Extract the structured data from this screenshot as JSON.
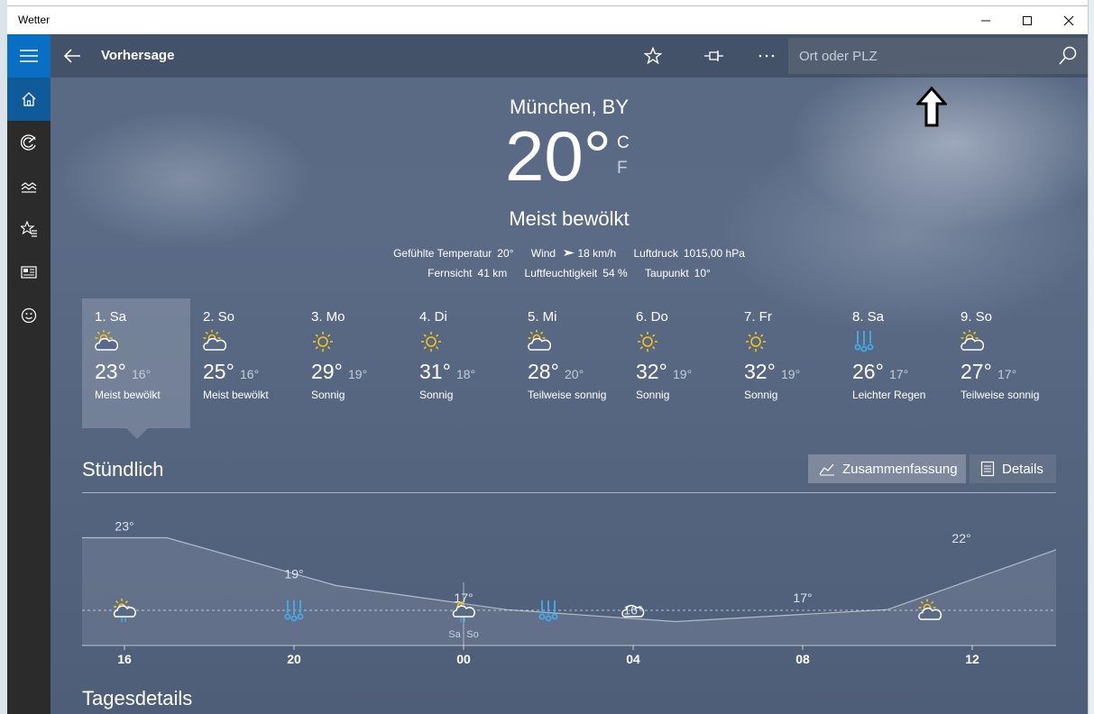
{
  "window": {
    "title": "Wetter",
    "controls": [
      "minimize",
      "maximize",
      "close"
    ]
  },
  "nav": {
    "items": [
      "menu-icon",
      "home-icon",
      "radar-icon",
      "historical-icon",
      "favorites-icon",
      "news-icon",
      "feedback-icon"
    ]
  },
  "topbar": {
    "title": "Vorhersage",
    "search_placeholder": "Ort oder PLZ"
  },
  "current": {
    "city": "München, BY",
    "temp": "20°",
    "unit_c": "C",
    "unit_f": "F",
    "condition": "Meist bewölkt",
    "stats_row1": [
      {
        "label": "Gefühlte Temperatur",
        "value": "20°"
      },
      {
        "label": "Wind",
        "value": "18 km/h",
        "icon": "wind-arrow-icon"
      },
      {
        "label": "Luftdruck",
        "value": "1015,00 hPa"
      }
    ],
    "stats_row2": [
      {
        "label": "Fernsicht",
        "value": "41 km"
      },
      {
        "label": "Luftfeuchtigkeit",
        "value": "54 %"
      },
      {
        "label": "Taupunkt",
        "value": "10°"
      }
    ]
  },
  "forecast": [
    {
      "day": "1. Sa",
      "icon": "partly-cloudy-icon",
      "hi": "23°",
      "lo": "16°",
      "cond": "Meist bewölkt",
      "selected": true
    },
    {
      "day": "2. So",
      "icon": "partly-cloudy-icon",
      "hi": "25°",
      "lo": "16°",
      "cond": "Meist bewölkt"
    },
    {
      "day": "3. Mo",
      "icon": "sunny-icon",
      "hi": "29°",
      "lo": "19°",
      "cond": "Sonnig"
    },
    {
      "day": "4. Di",
      "icon": "sunny-icon",
      "hi": "31°",
      "lo": "18°",
      "cond": "Sonnig"
    },
    {
      "day": "5. Mi",
      "icon": "partly-cloudy-icon",
      "hi": "28°",
      "lo": "20°",
      "cond": "Teilweise sonnig"
    },
    {
      "day": "6. Do",
      "icon": "sunny-icon",
      "hi": "32°",
      "lo": "19°",
      "cond": "Sonnig"
    },
    {
      "day": "7. Fr",
      "icon": "sunny-icon",
      "hi": "32°",
      "lo": "19°",
      "cond": "Sonnig"
    },
    {
      "day": "8. Sa",
      "icon": "rain-icon",
      "hi": "26°",
      "lo": "17°",
      "cond": "Leichter Regen"
    },
    {
      "day": "9. So",
      "icon": "partly-cloudy-icon",
      "hi": "27°",
      "lo": "17°",
      "cond": "Teilweise sonnig"
    }
  ],
  "hourly": {
    "title": "Stündlich",
    "summary_label": "Zusammenfassung",
    "details_label": "Details",
    "day_marker": [
      "Sa",
      "So"
    ],
    "icons": [
      "partly-cloudy-rain-icon",
      "rain-icon",
      "night-cloudy-rain-icon",
      "rain-icon",
      "cloudy-icon",
      "partly-cloudy-icon"
    ]
  },
  "chart_data": {
    "type": "area",
    "x_ticks": [
      "16",
      "20",
      "00",
      "04",
      "08",
      "12"
    ],
    "temperatures": [
      23,
      23,
      19,
      17,
      16,
      17,
      22
    ],
    "data_labels": [
      "23°",
      "19°",
      "17°",
      "16°",
      "17°",
      "22°"
    ],
    "ylim": [
      14,
      25
    ]
  },
  "tagesdetails": {
    "title": "Tagesdetails"
  },
  "colors": {
    "accent": "#0a6fc2",
    "sun": "#f5c518",
    "rain": "#3fb0f0",
    "nav_bg": "#2b2b2b"
  }
}
